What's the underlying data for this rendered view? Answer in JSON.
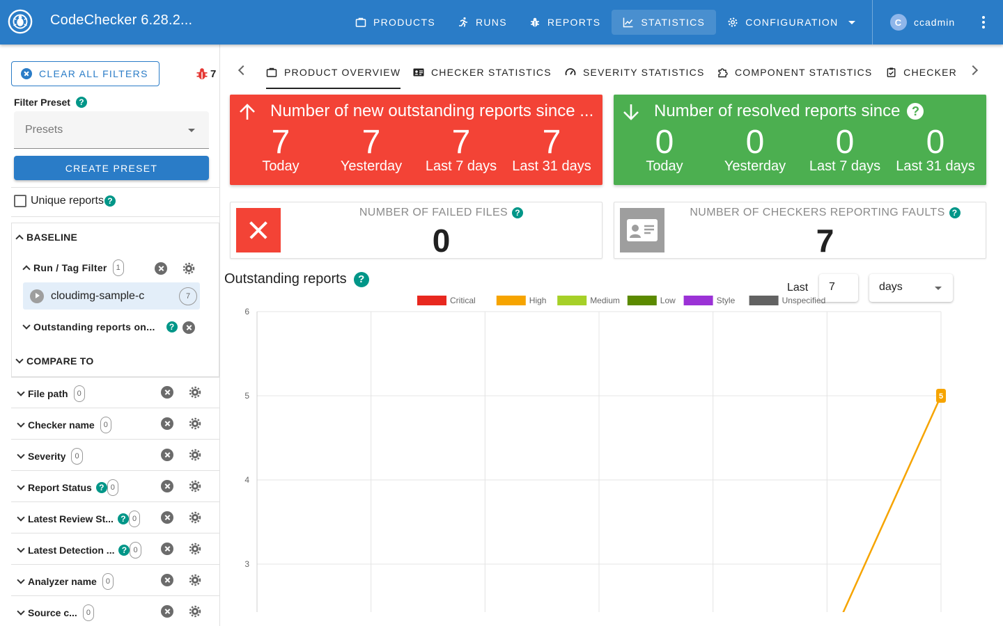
{
  "app": {
    "title": "CodeChecker 6.28.2..."
  },
  "nav": [
    {
      "label": "Products",
      "icon": "briefcase-icon"
    },
    {
      "label": "Runs",
      "icon": "run-icon"
    },
    {
      "label": "Reports",
      "icon": "bug-icon"
    },
    {
      "label": "Statistics",
      "icon": "chart-line-icon",
      "active": true
    },
    {
      "label": "Configuration",
      "icon": "gear-icon"
    }
  ],
  "user": {
    "initial": "C",
    "name": "ccadmin"
  },
  "sidebar": {
    "clear_filters": "CLEAR ALL FILTERS",
    "report_count": "7",
    "filter_preset_label": "Filter Preset",
    "presets_placeholder": "Presets",
    "create_preset": "CREATE PRESET",
    "unique_reports": "Unique reports",
    "baseline": "BASELINE",
    "run_tag_filter": "Run / Tag Filter",
    "run_tag_count": "1",
    "run_name": "cloudimg-sample-c",
    "run_count": "7",
    "outstanding_on": "Outstanding reports on...",
    "compare_to": "COMPARE TO",
    "filters": [
      {
        "label": "File path",
        "count": "0",
        "help": false
      },
      {
        "label": "Checker name",
        "count": "0",
        "help": false
      },
      {
        "label": "Severity",
        "count": "0",
        "help": false
      },
      {
        "label": "Report Status",
        "count": "0",
        "help": true
      },
      {
        "label": "Latest Review St...",
        "count": "0",
        "help": true
      },
      {
        "label": "Latest Detection ...",
        "count": "0",
        "help": true
      },
      {
        "label": "Analyzer name",
        "count": "0",
        "help": false
      },
      {
        "label": "Source c...",
        "count": "0",
        "help": false
      }
    ]
  },
  "tabs": [
    {
      "label": "Product overview",
      "icon": "briefcase-icon",
      "active": true
    },
    {
      "label": "Checker statistics",
      "icon": "id-card-icon"
    },
    {
      "label": "Severity statistics",
      "icon": "gauge-icon"
    },
    {
      "label": "Component statistics",
      "icon": "puzzle-icon"
    },
    {
      "label": "Checker",
      "icon": "clipboard-check-icon"
    }
  ],
  "new_reports": {
    "title": "Number of new outstanding reports since ...",
    "color": "#f34336",
    "stats": [
      {
        "value": "7",
        "label": "Today"
      },
      {
        "value": "7",
        "label": "Yesterday"
      },
      {
        "value": "7",
        "label": "Last 7 days"
      },
      {
        "value": "7",
        "label": "Last 31 days"
      }
    ]
  },
  "resolved_reports": {
    "title": "Number of resolved reports since",
    "color": "#4caf50",
    "stats": [
      {
        "value": "0",
        "label": "Today"
      },
      {
        "value": "0",
        "label": "Yesterday"
      },
      {
        "value": "0",
        "label": "Last 7 days"
      },
      {
        "value": "0",
        "label": "Last 31 days"
      }
    ]
  },
  "failed_files": {
    "caption": "NUMBER OF FAILED FILES",
    "value": "0"
  },
  "checkers_faults": {
    "caption": "NUMBER OF CHECKERS REPORTING FAULTS",
    "value": "7"
  },
  "outstanding": {
    "title": "Outstanding reports",
    "last_label": "Last",
    "last_value": "7",
    "unit": "days"
  },
  "chart_data": {
    "type": "line",
    "title": "Outstanding reports",
    "legend": [
      {
        "name": "Critical",
        "color": "#e8281f"
      },
      {
        "name": "High",
        "color": "#f6a400"
      },
      {
        "name": "Medium",
        "color": "#a6d028"
      },
      {
        "name": "Low",
        "color": "#5b8a00"
      },
      {
        "name": "Style",
        "color": "#9b32d6"
      },
      {
        "name": "Unspecified",
        "color": "#626262"
      }
    ],
    "legend_position": "top",
    "y_ticks": [
      3,
      4,
      5,
      6
    ],
    "ylim_visible": [
      2.4,
      6
    ],
    "x_points": 7,
    "series": [
      {
        "name": "High",
        "color": "#f6a400",
        "values": [
          null,
          null,
          null,
          null,
          null,
          2,
          5
        ]
      }
    ],
    "data_labels": [
      {
        "series": "High",
        "index": 6,
        "text": "5"
      }
    ],
    "grid": true
  }
}
